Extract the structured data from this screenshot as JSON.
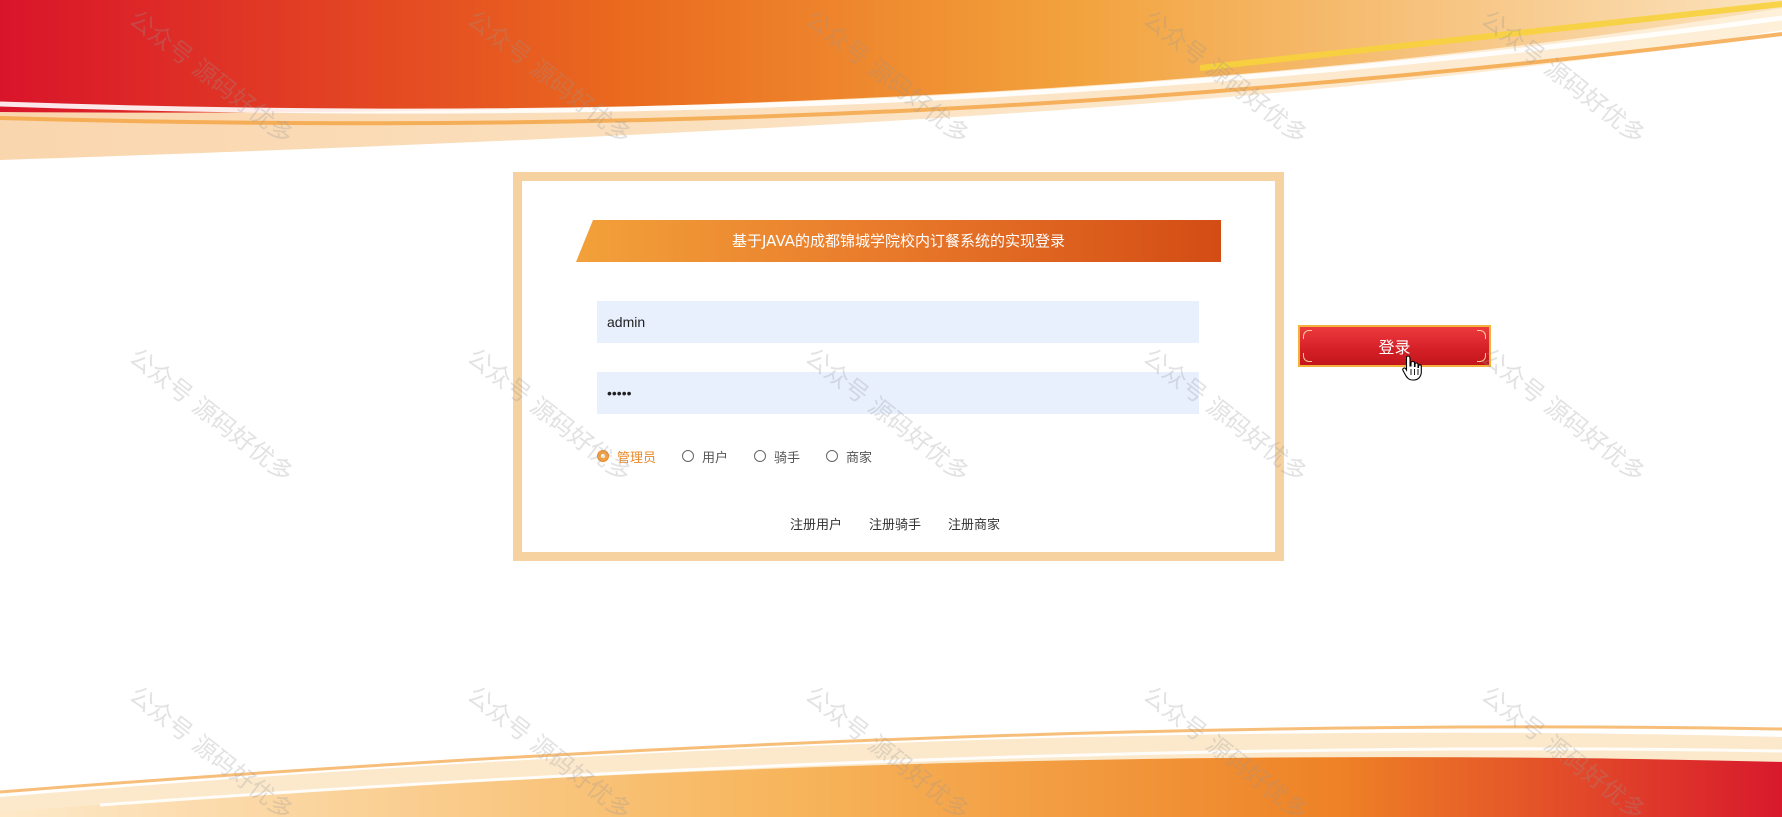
{
  "app": {
    "title": "基于JAVA的成都锦城学院校内订餐系统的实现登录"
  },
  "form": {
    "username_value": "admin",
    "password_value": "•••••",
    "login_button_label": "登录"
  },
  "roles": {
    "options": [
      "管理员",
      "用户",
      "骑手",
      "商家"
    ],
    "selected": "管理员"
  },
  "register": {
    "links": [
      "注册用户",
      "注册骑手",
      "注册商家"
    ]
  },
  "watermark": {
    "text": "公众号 源码好优多"
  },
  "colors": {
    "frame": "#f6d2a1",
    "banner_start": "#f2a13a",
    "banner_end": "#d34c14",
    "input_bg": "#e8f0fe",
    "button_red": "#d41f26",
    "button_border": "#f3b23c",
    "selected_role": "#e8892a"
  },
  "icons": {
    "cursor": "hand-pointer-icon",
    "radio_selected": "radio-checked-icon",
    "radio_unselected": "radio-unchecked-icon"
  }
}
